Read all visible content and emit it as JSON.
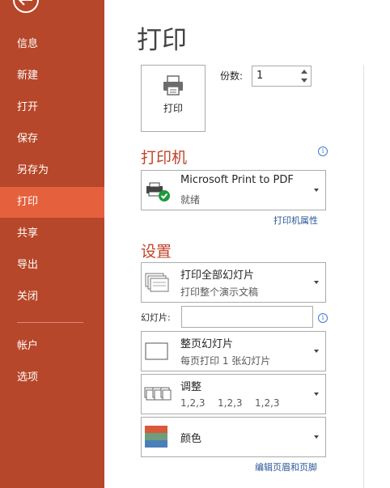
{
  "sidebar": {
    "items": [
      {
        "label": "信息"
      },
      {
        "label": "新建"
      },
      {
        "label": "打开"
      },
      {
        "label": "保存"
      },
      {
        "label": "另存为"
      },
      {
        "label": "打印",
        "active": true
      },
      {
        "label": "共享"
      },
      {
        "label": "导出"
      },
      {
        "label": "关闭"
      },
      {
        "label": "帐户"
      },
      {
        "label": "选项"
      }
    ]
  },
  "main": {
    "title": "打印",
    "print_button_label": "打印",
    "copies_label": "份数:",
    "copies_value": "1",
    "printer_heading": "打印机",
    "printer": {
      "name": "Microsoft Print to PDF",
      "status": "就绪"
    },
    "printer_properties_link": "打印机属性",
    "settings_heading": "设置",
    "range": {
      "title": "打印全部幻灯片",
      "subtitle": "打印整个演示文稿"
    },
    "slides_label": "幻灯片:",
    "slides_value": "",
    "layout": {
      "title": "整页幻灯片",
      "subtitle": "每页打印 1 张幻灯片"
    },
    "collation": {
      "title": "调整",
      "values": [
        "1,2,3",
        "1,2,3",
        "1,2,3"
      ]
    },
    "color": {
      "title": "颜色"
    },
    "header_footer_link": "编辑页眉和页脚"
  },
  "colors": {
    "sidebar": "#b7472a",
    "active": "#e5613e",
    "heading": "#c1442a",
    "link": "#2b5797"
  }
}
